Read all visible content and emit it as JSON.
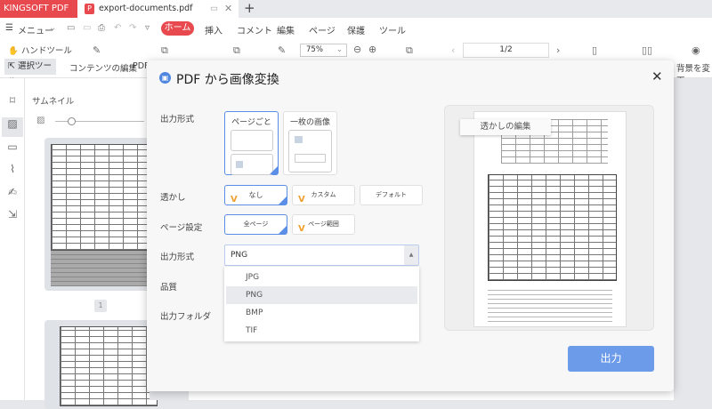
{
  "app": {
    "brand": "KINGSOFT PDF Pro",
    "tab_title": "export-documents.pdf",
    "new_tab": "+"
  },
  "menu": {
    "menu_label": "メニュー",
    "items": [
      "ホーム",
      "挿入",
      "コメント",
      "編集",
      "ページ",
      "保護",
      "ツール"
    ]
  },
  "toolbar": {
    "hand_tool": "ハンドツール",
    "select_tool": "選択ツール",
    "edit_content": "コンテンツの編集",
    "pdf_partial": "PDF",
    "zoom": "75%",
    "page": "1/2",
    "background": "背景を変更"
  },
  "sidebar": {
    "title": "サムネイル",
    "page_number": "1"
  },
  "dialog": {
    "title": "PDF から画像変換",
    "labels": {
      "output_mode": "出力形式",
      "watermark": "透かし",
      "page_setting": "ページ設定",
      "format": "出力形式",
      "quality": "品質",
      "folder": "出力フォルダ"
    },
    "output_mode_options": [
      "ページごと",
      "一枚の画像"
    ],
    "watermark_options": [
      "なし",
      "カスタム",
      "デフォルト"
    ],
    "page_options": [
      "全ページ",
      "ページ範囲"
    ],
    "format_value": "PNG",
    "format_options": [
      "JPG",
      "PNG",
      "BMP",
      "TIF"
    ],
    "preview_watermark": "透かしの編集",
    "output_button": "出力"
  },
  "colors": {
    "brand": "#e8494f",
    "accent": "#5b8ee6",
    "button": "#6c9bea"
  }
}
